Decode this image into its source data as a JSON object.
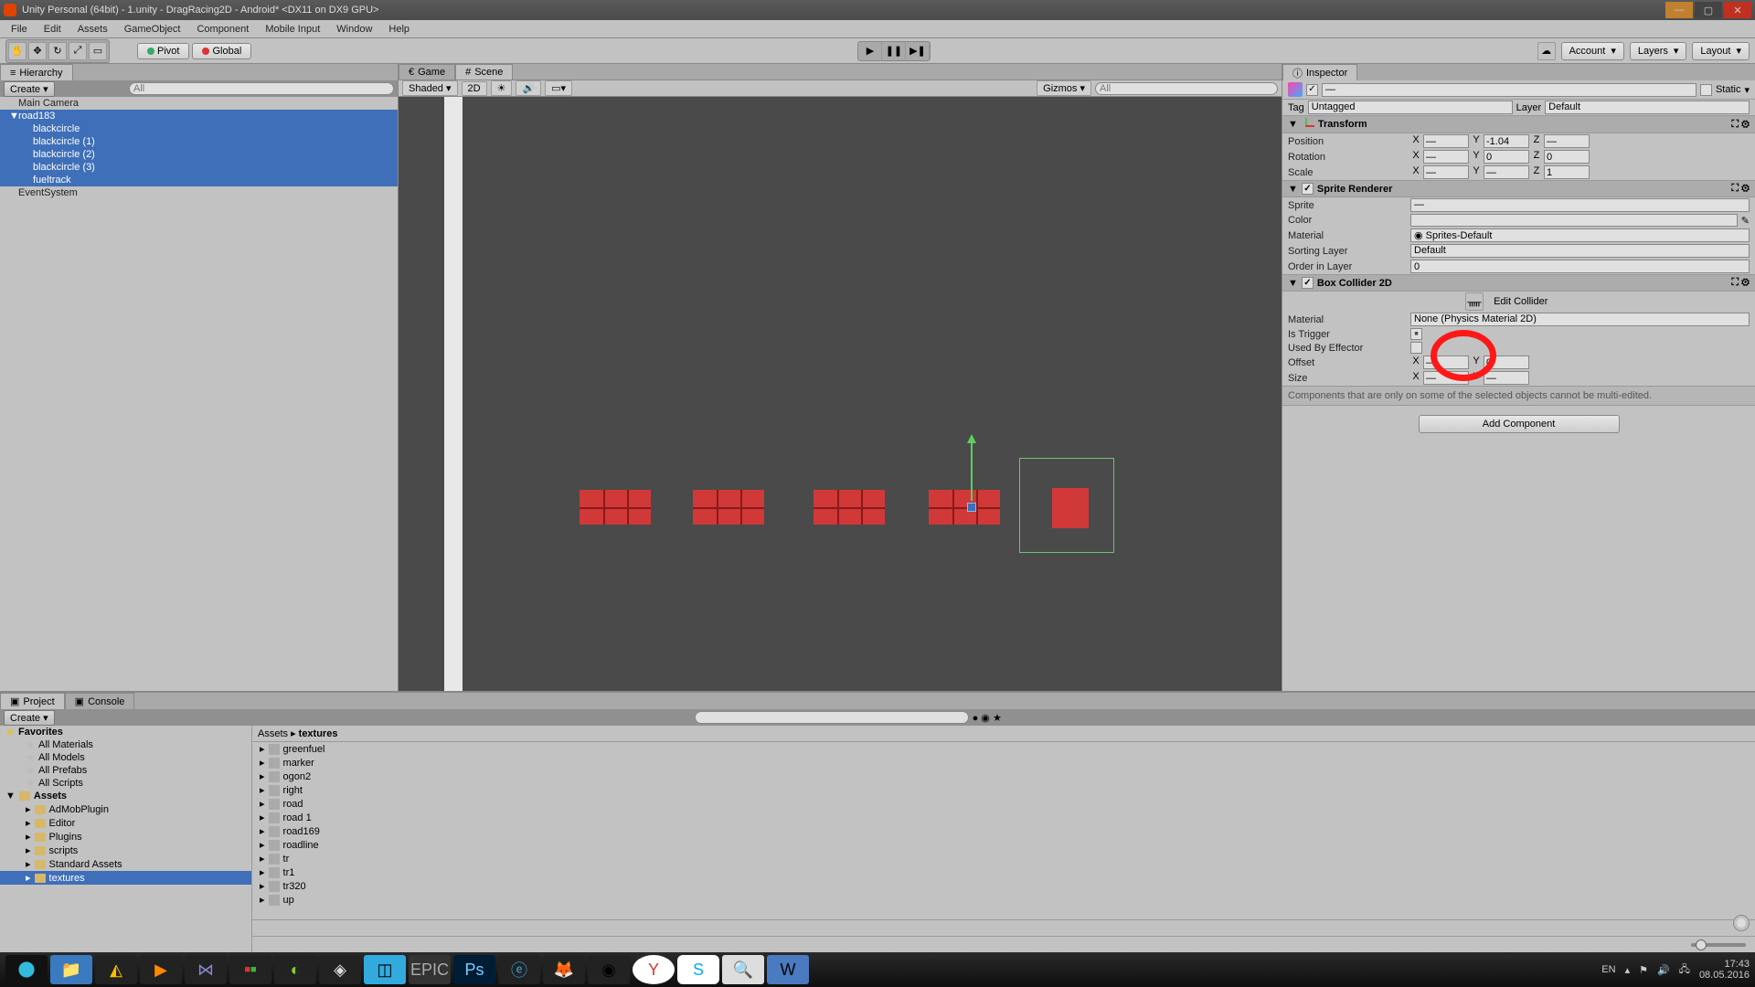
{
  "title": "Unity Personal (64bit) - 1.unity - DragRacing2D - Android* <DX11 on DX9 GPU>",
  "menu": [
    "File",
    "Edit",
    "Assets",
    "GameObject",
    "Component",
    "Mobile Input",
    "Window",
    "Help"
  ],
  "toolbar": {
    "pivot": "Pivot",
    "global": "Global",
    "account": "Account",
    "layers": "Layers",
    "layout": "Layout"
  },
  "hierarchy": {
    "tab": "Hierarchy",
    "create": "Create",
    "items": [
      {
        "name": "Main Camera",
        "sel": false,
        "indent": 0
      },
      {
        "name": "road183",
        "sel": true,
        "indent": 0,
        "expand": true
      },
      {
        "name": "blackcircle",
        "sel": true,
        "indent": 1
      },
      {
        "name": "blackcircle (1)",
        "sel": true,
        "indent": 1
      },
      {
        "name": "blackcircle (2)",
        "sel": true,
        "indent": 1
      },
      {
        "name": "blackcircle (3)",
        "sel": true,
        "indent": 1
      },
      {
        "name": "fueltrack",
        "sel": true,
        "indent": 1
      },
      {
        "name": "EventSystem",
        "sel": false,
        "indent": 0
      }
    ]
  },
  "scene": {
    "tabGame": "Game",
    "tabScene": "Scene",
    "shaded": "Shaded",
    "mode2d": "2D",
    "gizmos": "Gizmos"
  },
  "inspector": {
    "tab": "Inspector",
    "static": "Static",
    "tag": "Tag",
    "untagged": "Untagged",
    "layer": "Layer",
    "default": "Default",
    "transform": {
      "title": "Transform",
      "position": {
        "label": "Position",
        "x": "—",
        "y": "-1.04",
        "z": "—"
      },
      "rotation": {
        "label": "Rotation",
        "x": "—",
        "y": "0",
        "z": "0"
      },
      "scale": {
        "label": "Scale",
        "x": "—",
        "y": "—",
        "z": "1"
      }
    },
    "sprite": {
      "title": "Sprite Renderer",
      "sprite": "Sprite",
      "spriteVal": "—",
      "color": "Color",
      "material": "Material",
      "materialVal": "Sprites-Default",
      "sortingLayer": "Sorting Layer",
      "sortingVal": "Default",
      "orderInLayer": "Order in Layer",
      "orderVal": "0"
    },
    "box": {
      "title": "Box Collider 2D",
      "editCollider": "Edit Collider",
      "material": "Material",
      "materialVal": "None (Physics Material 2D)",
      "isTrigger": "Is Trigger",
      "usedByEffector": "Used By Effector",
      "offset": "Offset",
      "offsetX": "—",
      "offsetY": "0",
      "size": "Size",
      "sizeX": "—",
      "sizeY": "—"
    },
    "note": "Components that are only on some of the selected objects cannot be multi-edited.",
    "addComponent": "Add Component"
  },
  "project": {
    "tabProject": "Project",
    "tabConsole": "Console",
    "create": "Create",
    "favorites": "Favorites",
    "favItems": [
      "All Materials",
      "All Models",
      "All Prefabs",
      "All Scripts"
    ],
    "assets": "Assets",
    "folders": [
      "AdMobPlugin",
      "Editor",
      "Plugins",
      "scripts",
      "Standard Assets",
      "textures"
    ],
    "breadcrumb1": "Assets",
    "breadcrumb2": "textures",
    "files": [
      "greenfuel",
      "marker",
      "ogon2",
      "right",
      "road",
      "road 1",
      "road169",
      "roadline",
      "tr",
      "tr1",
      "tr320",
      "up"
    ]
  },
  "taskbar": {
    "lang": "EN",
    "time": "17:43",
    "date": "08.05.2016"
  }
}
